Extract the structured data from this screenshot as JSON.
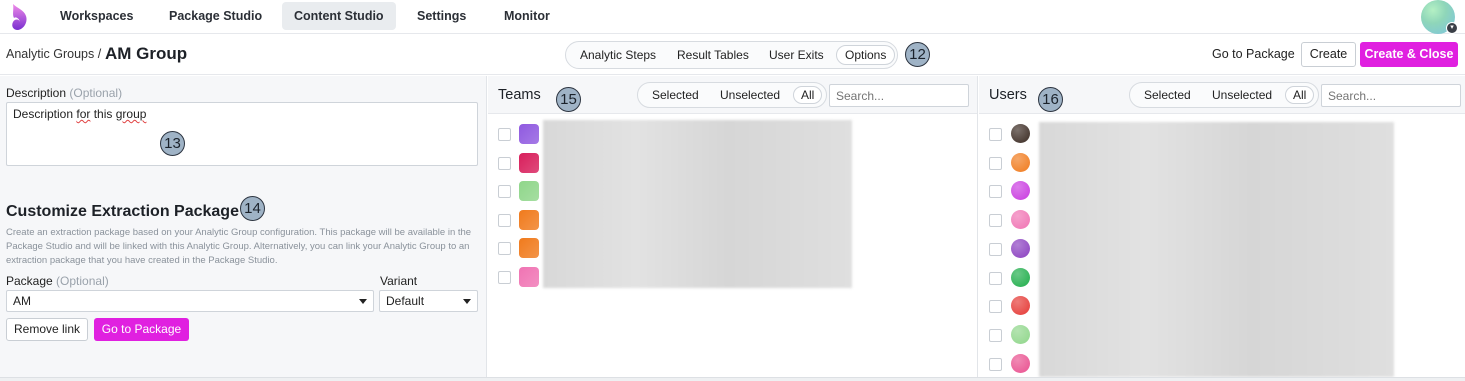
{
  "nav": {
    "tabs": [
      "Workspaces",
      "Package Studio",
      "Content Studio",
      "Settings",
      "Monitor"
    ],
    "active_tab": "Content Studio"
  },
  "subheader": {
    "breadcrumb": "Analytic Groups /",
    "title": "AM Group",
    "steps": [
      "Analytic Steps",
      "Result Tables",
      "User Exits",
      "Options"
    ],
    "active_step": "Options",
    "goto_package": "Go to Package",
    "create": "Create",
    "create_close": "Create & Close"
  },
  "markers": {
    "m12": "12",
    "m13": "13",
    "m14": "14",
    "m15": "15",
    "m16": "16"
  },
  "left": {
    "description_label": "Description",
    "optional": "(Optional)",
    "description_value_a": "Description ",
    "description_value_b": "for",
    "description_value_c": " this ",
    "description_value_d": "group",
    "section_title": "Customize Extraction Package",
    "section_desc": "Create an extraction package based on your Analytic Group configuration. This package will be available in the Package Studio and will be linked with this Analytic Group. Alternatively, you can link your Analytic Group to an extraction package that you have created in the Package Studio.",
    "package_label": "Package",
    "package_value": "AM",
    "variant_label": "Variant",
    "variant_value": "Default",
    "remove_link": "Remove link",
    "go_to_package": "Go to Package"
  },
  "teams": {
    "title": "Teams",
    "filters": [
      "Selected",
      "Unselected",
      "All"
    ],
    "active_filter": "All",
    "search_placeholder": "Search...",
    "swatch_colors": [
      "#8f59e0",
      "#d81e5b",
      "#8fd68a",
      "#f07a1c",
      "#f07a1c",
      "#f073b3"
    ]
  },
  "users": {
    "title": "Users",
    "filters": [
      "Selected",
      "Unselected",
      "All"
    ],
    "active_filter": "All",
    "search_placeholder": "Search...",
    "avatar_colors": [
      "#3a2a22",
      "#f07a1c",
      "#c93ae0",
      "#f073b3",
      "#8a3fc0",
      "#1fad4a",
      "#e53935",
      "#8fd68a",
      "#e9508f"
    ]
  }
}
